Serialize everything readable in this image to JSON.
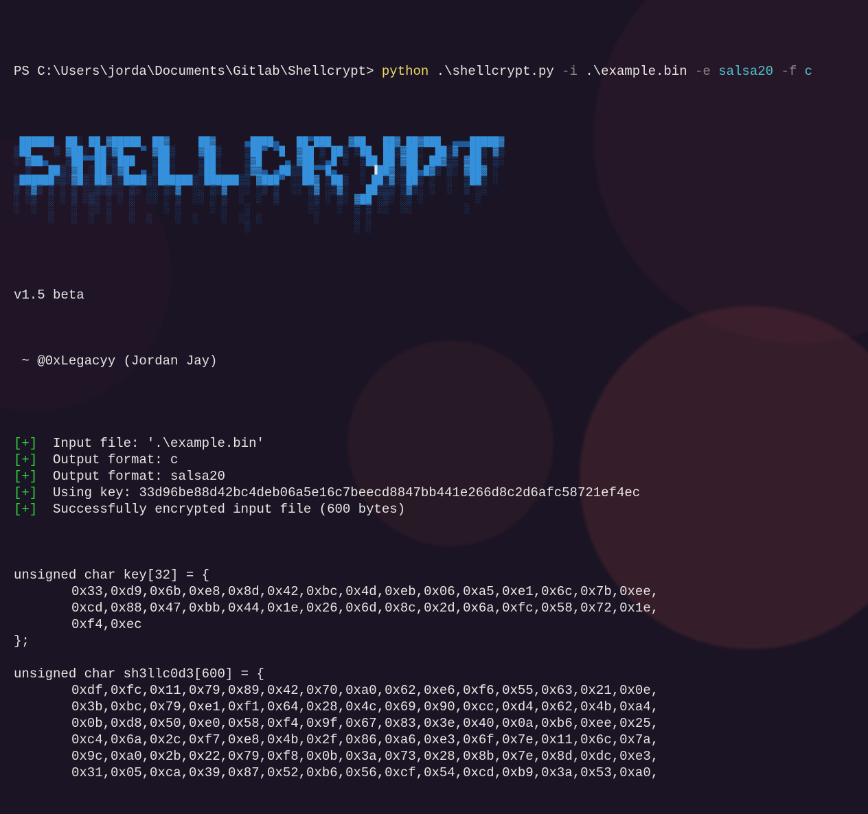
{
  "prompt": {
    "ps": "PS C:\\Users\\jorda\\Documents\\Gitlab\\Shellcrypt> ",
    "cmd": "python",
    "script": " .\\shellcrypt.py ",
    "flag_i": "-i",
    "arg_i": " .\\example.bin ",
    "flag_e": "-e",
    "arg_e": " salsa20 ",
    "flag_f": "-f",
    "arg_f": " c"
  },
  "banner_lines": [
    " ██████  ██░ ██ ▓█████  ██▓     ██▓     ▄████▄   ██▀███   ▓██   ██▓ ██▓███  ▄▄▄█████▓",
    "▒██    ▒ ▓██░ ██▒▓█   ▀ ▓██▒    ▓██▒    ▒██▀ ▀█  ▓██ ▒ ██▒ ▒██  ██▒▓██░  ██▒▓  ██▒ ▓▒",
    "░ ▓██▄   ▒██▀▀██░▒███   ▒██░    ▒██░    ▒▓█    ▄ ▓██ ░▄█ ▒  ▒██ ██░▓██░ ██▓▒▒ ▓██░ ▒░",
    "  ▒   ██▒░▓█ ░██ ▒▓█  ▄ ▒██░    ▒██░    ▒▓▓▄ ▄██▒▒██▀▀█▄    ░ ▐██▓░▒██▄█▓▒ ▒░ ▓██▓ ░ ",
    "▒██████▒▒░▓█▒░██▓░▒████▒░██████▒░██████▒▒ ▓███▀ ░░██▓ ▒██▒  ░ ██▒▓░▒██▒ ░  ░  ▒██▒ ░ ",
    "▒ ▒▓▒ ▒ ░ ▒ ░░▒░▒░░ ▒░ ░░ ▒░▓  ░░ ▒░▓  ░░ ░▒ ▒  ░░ ▒▓ ░▒▓░   ██▒▒▒ ▒▓▒░ ░  ░  ▒ ░░   ",
    "░ ░▒  ░ ░ ▒ ░▒░ ░ ░ ░  ░░ ░ ▒  ░░ ░ ▒  ░  ░  ▒     ░▒ ░ ▒░ ▓██ ░▒░ ░▒ ░         ░    ",
    "░  ░  ░   ░  ░░ ░   ░     ░ ░     ░ ░   ░          ░░   ░  ▒ ▒ ░░  ░░         ░      ",
    "      ░   ░  ░  ░   ░  ░    ░  ░    ░  ░░ ░         ░      ░ ░                       ",
    "                                        ░                  ░ ░                       "
  ],
  "version": "v1.5 beta",
  "author": " ~ @0xLegacyy (Jordan Jay)",
  "status": [
    "Input file: '.\\example.bin'",
    "Output format: c",
    "Output format: salsa20",
    "Using key: 33d96be88d42bc4deb06a5e16c7beecd8847bb441e266d8c2d6afc58721ef4ec",
    "Successfully encrypted input file (600 bytes)"
  ],
  "code": {
    "key_decl": "unsigned char key[32] = {",
    "key_lines": [
      "0x33,0xd9,0x6b,0xe8,0x8d,0x42,0xbc,0x4d,0xeb,0x06,0xa5,0xe1,0x6c,0x7b,0xee,",
      "0xcd,0x88,0x47,0xbb,0x44,0x1e,0x26,0x6d,0x8c,0x2d,0x6a,0xfc,0x58,0x72,0x1e,",
      "0xf4,0xec"
    ],
    "key_close": "};",
    "sh_decl": "unsigned char sh3llc0d3[600] = {",
    "sh_lines": [
      "0xdf,0xfc,0x11,0x79,0x89,0x42,0x70,0xa0,0x62,0xe6,0xf6,0x55,0x63,0x21,0x0e,",
      "0x3b,0xbc,0x79,0xe1,0xf1,0x64,0x28,0x4c,0x69,0x90,0xcc,0xd4,0x62,0x4b,0xa4,",
      "0x0b,0xd8,0x50,0xe0,0x58,0xf4,0x9f,0x67,0x83,0x3e,0x40,0x0a,0xb6,0xee,0x25,",
      "0xc4,0x6a,0x2c,0xf7,0xe8,0x4b,0x2f,0x86,0xa6,0xe3,0x6f,0x7e,0x11,0x6c,0x7a,",
      "0x9c,0xa0,0x2b,0x22,0x79,0xf8,0x0b,0x3a,0x73,0x28,0x8b,0x7e,0x8d,0xdc,0xe3,",
      "0x31,0x05,0xca,0x39,0x87,0x52,0xb6,0x56,0xcf,0x54,0xcd,0xb9,0x3a,0x53,0xa0,"
    ]
  }
}
